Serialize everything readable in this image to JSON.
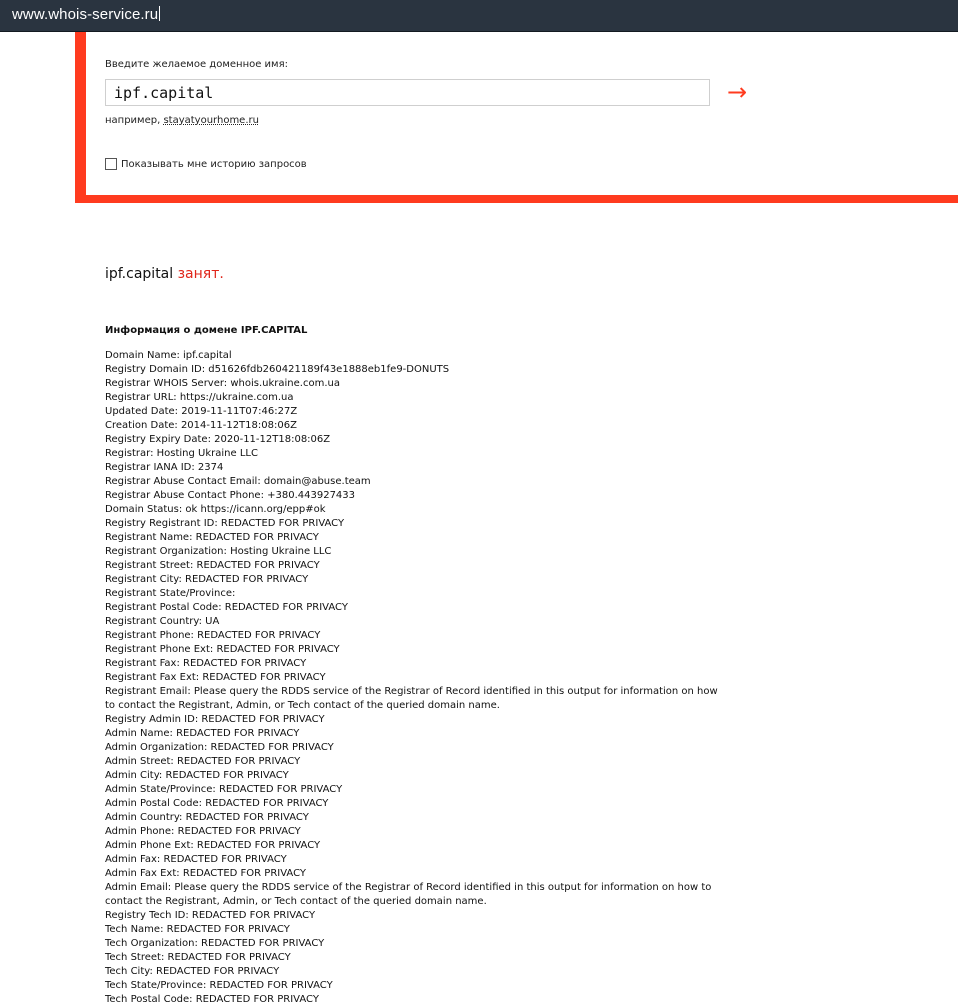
{
  "browser": {
    "url": "www.whois-service.ru"
  },
  "search": {
    "prompt": "Введите желаемое доменное имя:",
    "value": "ipf.capital",
    "submit_icon": "→",
    "example_prefix": "например, ",
    "example_link": "stayatyourhome.ru",
    "history_label": "Показывать мне историю запросов",
    "accent_color": "#ff3b1f"
  },
  "result": {
    "domain": "ipf.capital",
    "status": "занят.",
    "info_heading": "Информация о домене IPF.CAPITAL",
    "lines": [
      "Domain Name: ipf.capital",
      "Registry Domain ID: d51626fdb260421189f43e1888eb1fe9-DONUTS",
      "Registrar WHOIS Server: whois.ukraine.com.ua",
      "Registrar URL: https://ukraine.com.ua",
      "Updated Date: 2019-11-11T07:46:27Z",
      "Creation Date: 2014-11-12T18:08:06Z",
      "Registry Expiry Date: 2020-11-12T18:08:06Z",
      "Registrar: Hosting Ukraine LLC",
      "Registrar IANA ID: 2374",
      "Registrar Abuse Contact Email: domain@abuse.team",
      "Registrar Abuse Contact Phone: +380.443927433",
      "Domain Status: ok https://icann.org/epp#ok",
      "Registry Registrant ID: REDACTED FOR PRIVACY",
      "Registrant Name: REDACTED FOR PRIVACY",
      "Registrant Organization: Hosting Ukraine LLC",
      "Registrant Street: REDACTED FOR PRIVACY",
      "Registrant City: REDACTED FOR PRIVACY",
      "Registrant State/Province:",
      "Registrant Postal Code: REDACTED FOR PRIVACY",
      "Registrant Country: UA",
      "Registrant Phone: REDACTED FOR PRIVACY",
      "Registrant Phone Ext: REDACTED FOR PRIVACY",
      "Registrant Fax: REDACTED FOR PRIVACY",
      "Registrant Fax Ext: REDACTED FOR PRIVACY",
      "Registrant Email: Please query the RDDS service of the Registrar of Record identified in this output for information on how",
      "to contact the Registrant, Admin, or Tech contact of the queried domain name.",
      "Registry Admin ID: REDACTED FOR PRIVACY",
      "Admin Name: REDACTED FOR PRIVACY",
      "Admin Organization: REDACTED FOR PRIVACY",
      "Admin Street: REDACTED FOR PRIVACY",
      "Admin City: REDACTED FOR PRIVACY",
      "Admin State/Province: REDACTED FOR PRIVACY",
      "Admin Postal Code: REDACTED FOR PRIVACY",
      "Admin Country: REDACTED FOR PRIVACY",
      "Admin Phone: REDACTED FOR PRIVACY",
      "Admin Phone Ext: REDACTED FOR PRIVACY",
      "Admin Fax: REDACTED FOR PRIVACY",
      "Admin Fax Ext: REDACTED FOR PRIVACY",
      "Admin Email: Please query the RDDS service of the Registrar of Record identified in this output for information on how to",
      "contact the Registrant, Admin, or Tech contact of the queried domain name.",
      "Registry Tech ID: REDACTED FOR PRIVACY",
      "Tech Name: REDACTED FOR PRIVACY",
      "Tech Organization: REDACTED FOR PRIVACY",
      "Tech Street: REDACTED FOR PRIVACY",
      "Tech City: REDACTED FOR PRIVACY",
      "Tech State/Province: REDACTED FOR PRIVACY",
      "Tech Postal Code: REDACTED FOR PRIVACY"
    ]
  }
}
